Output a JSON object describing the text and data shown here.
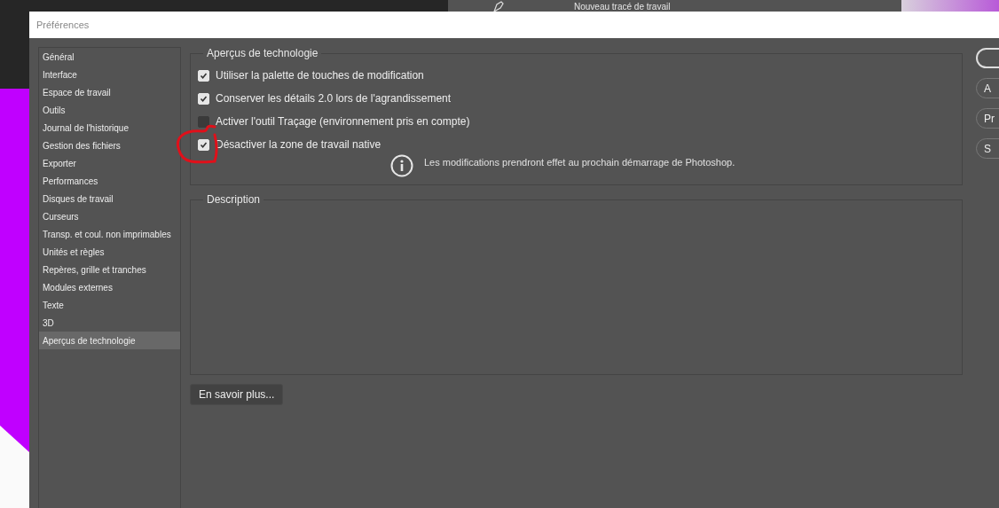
{
  "background": {
    "panel_item": "Nouveau tracé de travail"
  },
  "window": {
    "title": "Préférences"
  },
  "sidebar": {
    "items": [
      {
        "label": "Général",
        "selected": false
      },
      {
        "label": "Interface",
        "selected": false
      },
      {
        "label": "Espace de travail",
        "selected": false
      },
      {
        "label": "Outils",
        "selected": false
      },
      {
        "label": "Journal de l'historique",
        "selected": false
      },
      {
        "label": "Gestion des fichiers",
        "selected": false
      },
      {
        "label": "Exporter",
        "selected": false
      },
      {
        "label": "Performances",
        "selected": false
      },
      {
        "label": "Disques de travail",
        "selected": false
      },
      {
        "label": "Curseurs",
        "selected": false
      },
      {
        "label": "Transp. et coul. non imprimables",
        "selected": false
      },
      {
        "label": "Unités et règles",
        "selected": false
      },
      {
        "label": "Repères, grille et tranches",
        "selected": false
      },
      {
        "label": "Modules externes",
        "selected": false
      },
      {
        "label": "Texte",
        "selected": false
      },
      {
        "label": "3D",
        "selected": false
      },
      {
        "label": "Aperçus de technologie",
        "selected": true
      }
    ]
  },
  "tech_previews": {
    "title": "Aperçus de technologie",
    "options": [
      {
        "label": "Utiliser la palette de touches de modification",
        "checked": true
      },
      {
        "label": "Conserver les détails 2.0 lors de l'agrandissement",
        "checked": true
      },
      {
        "label": "Activer l'outil Traçage (environnement pris en compte)",
        "checked": false
      },
      {
        "label": "Désactiver la zone de travail native",
        "checked": true
      }
    ],
    "notice": "Les modifications prendront effet au prochain démarrage de Photoshop."
  },
  "description": {
    "title": "Description"
  },
  "learn_more_button": "En savoir plus...",
  "side_buttons": [
    {
      "kind": "primary"
    },
    {
      "kind": "plain",
      "label": "A"
    },
    {
      "kind": "plain",
      "label": "Pr"
    },
    {
      "kind": "plain",
      "label": "S"
    }
  ]
}
